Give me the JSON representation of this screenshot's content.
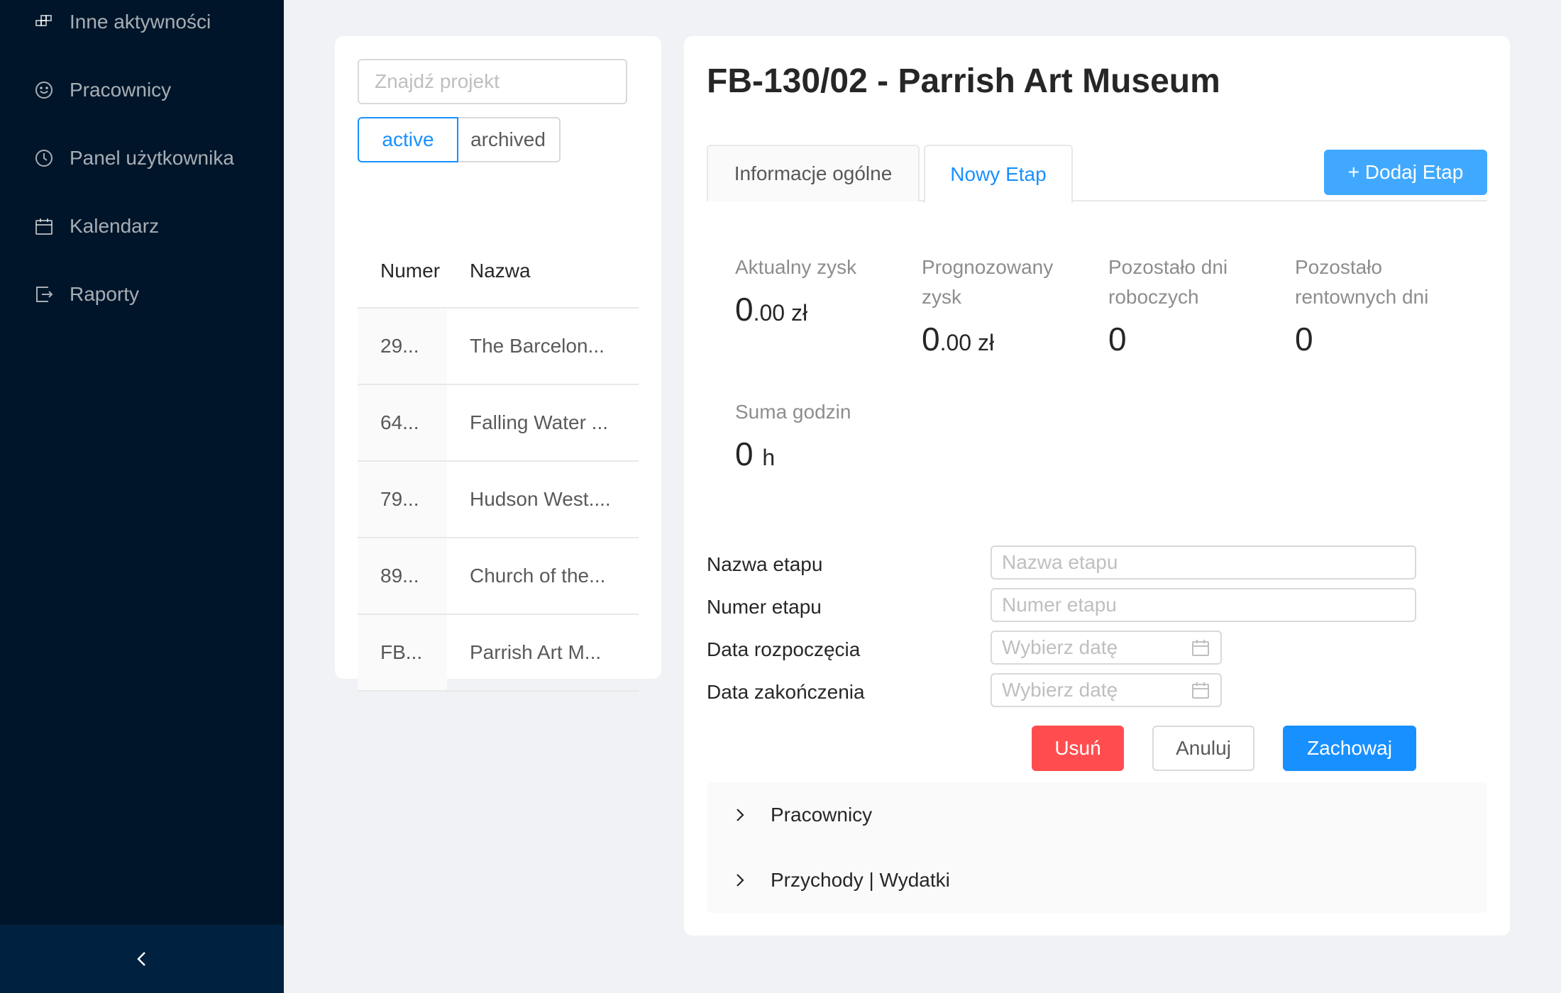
{
  "sidebar": {
    "items": [
      {
        "label": "Inne aktywności",
        "icon": "blocks-icon"
      },
      {
        "label": "Pracownicy",
        "icon": "smile-icon"
      },
      {
        "label": "Panel użytkownika",
        "icon": "clock-icon"
      },
      {
        "label": "Kalendarz",
        "icon": "calendar-icon"
      },
      {
        "label": "Raporty",
        "icon": "export-icon"
      }
    ],
    "collapse_icon": "chevron-left-icon"
  },
  "projects": {
    "search_placeholder": "Znajdź projekt",
    "filter": {
      "active_label": "active",
      "archived_label": "archived",
      "selected": "active"
    },
    "columns": {
      "number": "Numer",
      "name": "Nazwa"
    },
    "rows": [
      {
        "number": "29...",
        "name": "The Barcelon..."
      },
      {
        "number": "64...",
        "name": "Falling Water ..."
      },
      {
        "number": "79...",
        "name": "Hudson West...."
      },
      {
        "number": "89...",
        "name": "Church of the..."
      },
      {
        "number": "FB...",
        "name": "Parrish Art M..."
      }
    ]
  },
  "detail": {
    "title": "FB-130/02 - Parrish Art Museum",
    "tabs": [
      {
        "label": "Informacje ogólne",
        "active": false
      },
      {
        "label": "Nowy Etap",
        "active": true
      }
    ],
    "add_stage_label": "+ Dodaj Etap",
    "stats": {
      "current_profit": {
        "label": "Aktualny zysk",
        "int": "0",
        "dec": ".00 zł"
      },
      "forecast_profit": {
        "label": "Prognozowany zysk",
        "int": "0",
        "dec": ".00 zł"
      },
      "working_days": {
        "label": "Pozostało dni roboczych",
        "value": "0"
      },
      "profitable_days": {
        "label": "Pozostało rentownych dni",
        "value": "0"
      },
      "hours": {
        "label": "Suma godzin",
        "value": "0",
        "unit": "h"
      }
    },
    "form": {
      "stage_name": {
        "label": "Nazwa etapu",
        "placeholder": "Nazwa etapu",
        "value": ""
      },
      "stage_number": {
        "label": "Numer etapu",
        "placeholder": "Numer etapu",
        "value": ""
      },
      "start_date": {
        "label": "Data rozpoczęcia",
        "placeholder": "Wybierz datę",
        "value": ""
      },
      "end_date": {
        "label": "Data zakończenia",
        "placeholder": "Wybierz datę",
        "value": ""
      }
    },
    "buttons": {
      "delete": "Usuń",
      "cancel": "Anuluj",
      "save": "Zachowaj"
    },
    "panels": [
      {
        "label": "Pracownicy"
      },
      {
        "label": "Przychody | Wydatki"
      }
    ]
  },
  "colors": {
    "sidebar_bg": "#001529",
    "primary": "#1890ff",
    "danger": "#ff4d4f",
    "page_bg": "#f0f2f5"
  }
}
